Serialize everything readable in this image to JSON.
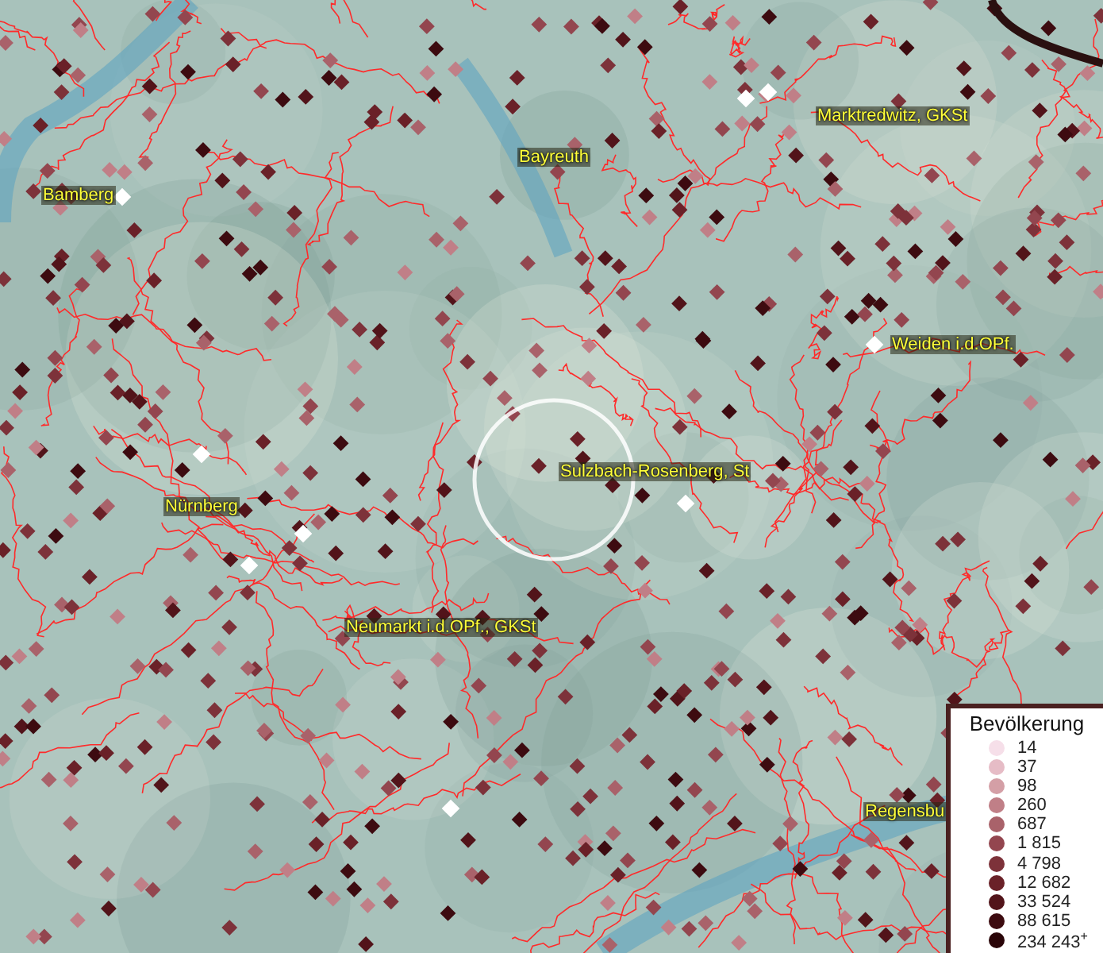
{
  "map": {
    "places": [
      {
        "name": "Bamberg"
      },
      {
        "name": "Bayreuth"
      },
      {
        "name": "Marktredwitz, GKSt"
      },
      {
        "name": "Weiden i.d.OPf."
      },
      {
        "name": "Nürnberg"
      },
      {
        "name": "Sulzbach-Rosenberg, St"
      },
      {
        "name": "Neumarkt i.d.OPf., GKSt"
      },
      {
        "name": "Regensbu"
      }
    ]
  },
  "legend": {
    "title": "Bevölkerung",
    "entries": [
      {
        "label": "14",
        "color": "#f6dfe9"
      },
      {
        "label": "37",
        "color": "#e6bcc6"
      },
      {
        "label": "98",
        "color": "#d49fa6"
      },
      {
        "label": "260",
        "color": "#c07f87"
      },
      {
        "label": "687",
        "color": "#a9626a"
      },
      {
        "label": "1 815",
        "color": "#93464f"
      },
      {
        "label": "4 798",
        "color": "#7d323a"
      },
      {
        "label": "12 682",
        "color": "#6a2128"
      },
      {
        "label": "33 524",
        "color": "#52141a"
      },
      {
        "label": "88 615",
        "color": "#3d0b10"
      },
      {
        "label": "234 243$^{+}$",
        "color": "#2a0508"
      }
    ]
  }
}
